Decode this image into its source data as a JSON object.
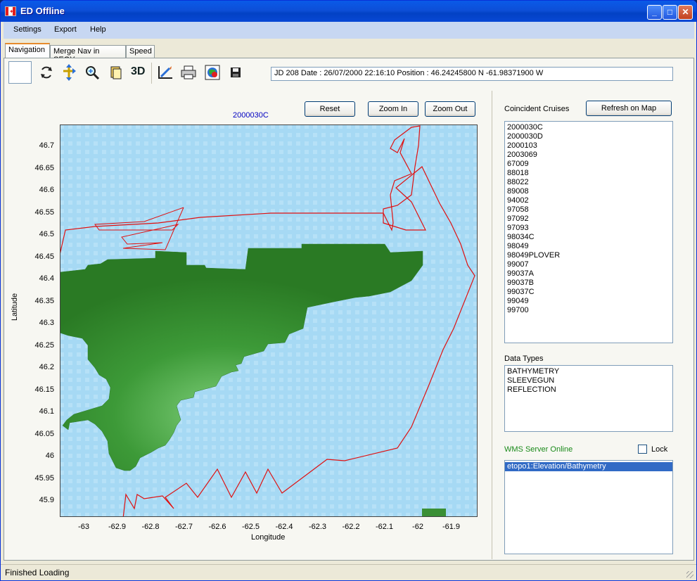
{
  "window": {
    "title": "ED Offline"
  },
  "menu": [
    "Settings",
    "Export",
    "Help"
  ],
  "tabs": [
    "Navigation",
    "Merge Nav in SEGY",
    "Speed"
  ],
  "toolbar": {
    "three_d_label": "3D",
    "status_text": "JD 208 Date : 26/07/2000 22:16:10  Position : 46.24245800 N -61.98371900 W"
  },
  "map": {
    "title": "2000030C",
    "reset_label": "Reset",
    "zoom_in_label": "Zoom In",
    "zoom_out_label": "Zoom Out",
    "xlabel": "Longitude",
    "ylabel": "Latitude",
    "xticks": [
      "-63",
      "-62.9",
      "-62.8",
      "-62.7",
      "-62.6",
      "-62.5",
      "-62.4",
      "-62.3",
      "-62.2",
      "-62.1",
      "-62",
      "-61.9"
    ],
    "yticks": [
      "46.7",
      "46.65",
      "46.6",
      "46.55",
      "46.5",
      "46.45",
      "46.4",
      "46.35",
      "46.3",
      "46.25",
      "46.2",
      "46.15",
      "46.1",
      "46.05",
      "46",
      "45.95",
      "45.9"
    ]
  },
  "sidebar": {
    "coincident_label": "Coincident Cruises",
    "refresh_label": "Refresh on Map",
    "cruises": [
      "2000030C",
      "2000030D",
      "2000103",
      "2003069",
      "67009",
      "88018",
      "88022",
      "89008",
      "94002",
      "97058",
      "97092",
      "97093",
      "98034C",
      "98049",
      "98049PLOVER",
      "99007",
      "99037A",
      "99037B",
      "99037C",
      "99049",
      "99700"
    ],
    "data_types_label": "Data Types",
    "data_types": [
      "BATHYMETRY",
      "SLEEVEGUN",
      "REFLECTION"
    ],
    "wms_status": "WMS Server Online",
    "lock_label": "Lock",
    "layers": [
      "etopo1:Elevation/Bathymetry"
    ]
  },
  "status": {
    "text": "Finished Loading"
  },
  "colors": {
    "land": "#3f9a3a",
    "track": "#e01010",
    "water": "#a6d9f4",
    "wms_online": "#1a8a1a",
    "selection": "#316ac5"
  }
}
